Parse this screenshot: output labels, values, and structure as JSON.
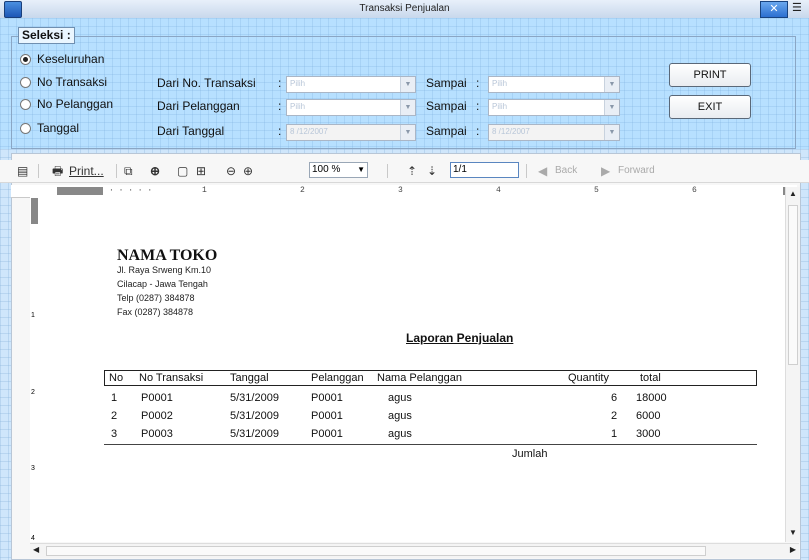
{
  "window": {
    "title": "Transaksi Penjualan"
  },
  "selection": {
    "group_title": "Seleksi :",
    "options": [
      {
        "label": "Keseluruhan",
        "checked": true
      },
      {
        "label": "No Transaksi",
        "checked": false
      },
      {
        "label": "No Pelanggan",
        "checked": false
      },
      {
        "label": "Tanggal",
        "checked": false
      }
    ],
    "rows": [
      {
        "from_label": "Dari No. Transaksi",
        "colon": ":",
        "from_value": "Pilih",
        "to_label": "Sampai",
        "to_colon": ":",
        "to_value": "Pilih"
      },
      {
        "from_label": "Dari Pelanggan",
        "colon": ":",
        "from_value": "Pilih",
        "to_label": "Sampai",
        "to_colon": ":",
        "to_value": "Pilih"
      },
      {
        "from_label": "Dari Tanggal",
        "colon": ":",
        "from_value": "8 /12/2007",
        "to_label": "Sampai",
        "to_colon": ":",
        "to_value": "8 /12/2007"
      }
    ],
    "buttons": {
      "print": "PRINT",
      "exit": "EXIT"
    }
  },
  "toolbar": {
    "print_label": "Print...",
    "zoom_value": "100 %",
    "page_value": "1/1",
    "back_label": "Back",
    "forward_label": "Forward"
  },
  "ruler": {
    "numbers": [
      "1",
      "2",
      "3",
      "4",
      "5",
      "6"
    ],
    "vertical_numbers": [
      "1",
      "2",
      "3",
      "4"
    ]
  },
  "report": {
    "store_name": "NAMA TOKO",
    "address_lines": [
      "Jl. Raya Srweng Km.10",
      "Cilacap - Jawa Tengah",
      "Telp (0287) 384878",
      "Fax (0287) 384878"
    ],
    "title": "Laporan Penjualan",
    "columns": [
      "No",
      "No Transaksi",
      "Tanggal",
      "Pelanggan",
      "Nama Pelanggan",
      "Quantity",
      "total"
    ],
    "rows": [
      [
        "1",
        "P0001",
        "5/31/2009",
        "P0001",
        "agus",
        "6",
        "18000"
      ],
      [
        "2",
        "P0002",
        "5/31/2009",
        "P0001",
        "agus",
        "2",
        "6000"
      ],
      [
        "3",
        "P0003",
        "5/31/2009",
        "P0001",
        "agus",
        "1",
        "3000"
      ]
    ],
    "footer_label": "Jumlah"
  },
  "colors": {
    "panel_bg": "#b7e0ff",
    "window_bg": "#cfe6fb"
  },
  "icons": [
    "app-icon",
    "close-icon",
    "menu-icon",
    "tree-toggle-icon",
    "printer-icon",
    "copy-icon",
    "find-icon",
    "single-page-icon",
    "multi-page-icon",
    "zoom-out-icon",
    "zoom-in-icon",
    "page-up-icon",
    "page-down-icon",
    "back-icon",
    "forward-icon"
  ]
}
